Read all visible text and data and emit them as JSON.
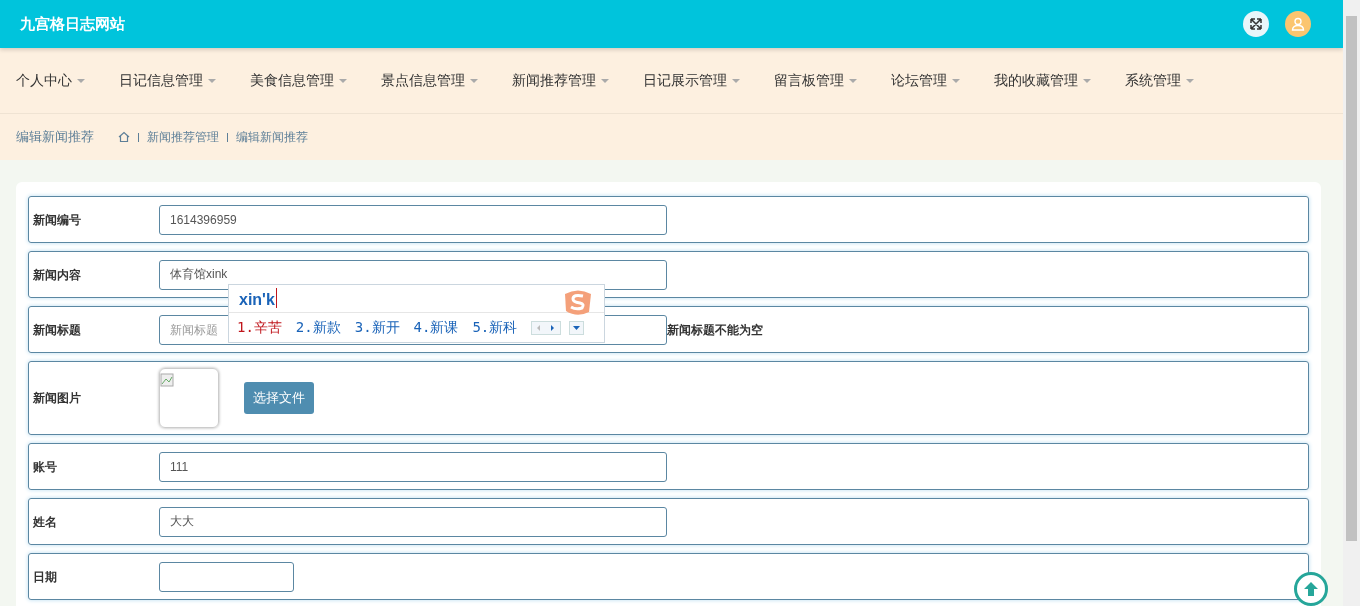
{
  "header": {
    "title": "九宫格日志网站"
  },
  "nav": [
    {
      "label": "个人中心"
    },
    {
      "label": "日记信息管理"
    },
    {
      "label": "美食信息管理"
    },
    {
      "label": "景点信息管理"
    },
    {
      "label": "新闻推荐管理"
    },
    {
      "label": "日记展示管理"
    },
    {
      "label": "留言板管理"
    },
    {
      "label": "论坛管理"
    },
    {
      "label": "我的收藏管理"
    },
    {
      "label": "系统管理"
    }
  ],
  "breadcrumb": {
    "page_title": "编辑新闻推荐",
    "trail": [
      "新闻推荐管理",
      "编辑新闻推荐"
    ]
  },
  "form": [
    {
      "kind": "text",
      "label": "新闻编号",
      "value": "1614396959"
    },
    {
      "kind": "text",
      "label": "新闻内容",
      "value": "体育馆xink"
    },
    {
      "kind": "text",
      "label": "新闻标题",
      "placeholder": "新闻标题",
      "error": "新闻标题不能为空"
    },
    {
      "kind": "image",
      "label": "新闻图片",
      "button": "选择文件"
    },
    {
      "kind": "text",
      "label": "账号",
      "value": "111"
    },
    {
      "kind": "text",
      "label": "姓名",
      "value": "大大"
    },
    {
      "kind": "date",
      "label": "日期"
    }
  ],
  "ime": {
    "composition": "xin'k",
    "candidates": [
      {
        "text": "1.辛苦",
        "selected": true
      },
      {
        "text": "2.新款",
        "selected": false
      },
      {
        "text": "3.新开",
        "selected": false
      },
      {
        "text": "4.新课",
        "selected": false
      },
      {
        "text": "5.新科",
        "selected": false
      }
    ]
  }
}
